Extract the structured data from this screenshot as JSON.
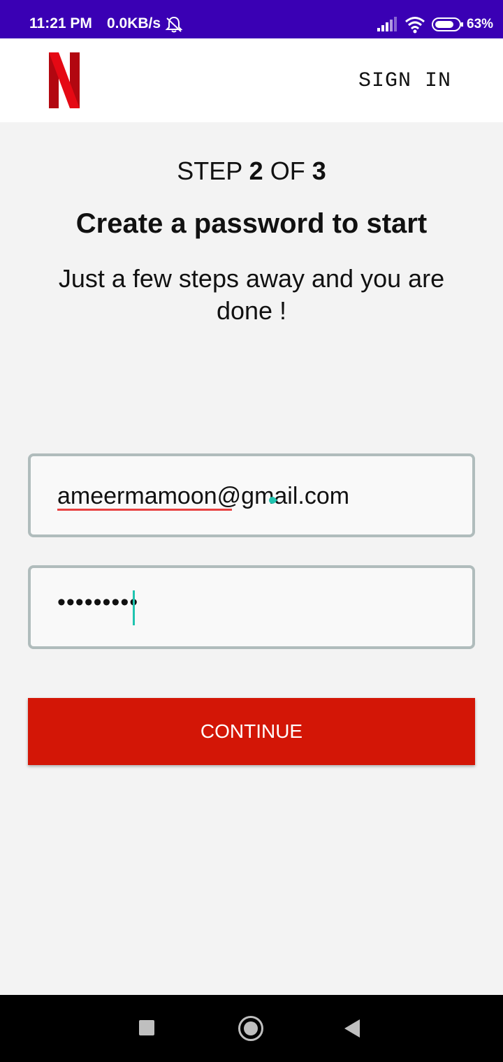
{
  "status_bar": {
    "time": "11:21 PM",
    "speed": "0.0KB/s",
    "battery": "63%",
    "icons": [
      "mute-bell-icon",
      "signal-icon",
      "wifi-icon",
      "battery-icon"
    ]
  },
  "header": {
    "logo": "netflix-n-logo",
    "sign_in": "SIGN IN"
  },
  "content": {
    "step_prefix": "STEP ",
    "step_current": "2",
    "step_middle": " OF ",
    "step_total": "3",
    "title": "Create a password to start",
    "subtitle": "Just a few steps away and you are done !"
  },
  "form": {
    "email_value": "ameermamoon@gmail.com",
    "password_value": "•••••••••",
    "continue_label": "CONTINUE"
  },
  "colors": {
    "status_bar": "#3a00b4",
    "brand_red": "#d31606",
    "cursor": "#20c4b0"
  },
  "nav_bar": {
    "icons": [
      "recent-apps-icon",
      "home-icon",
      "back-icon"
    ]
  }
}
